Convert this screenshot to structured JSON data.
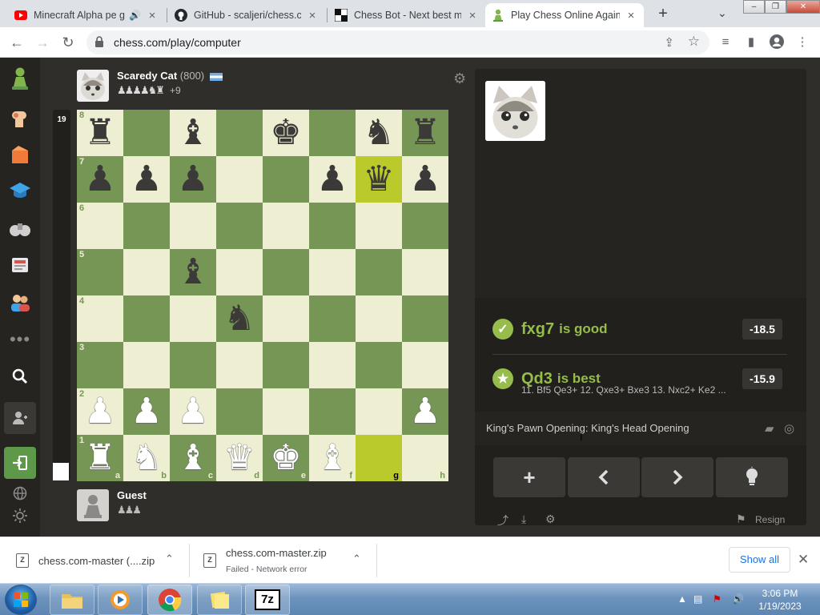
{
  "browser": {
    "tabs": [
      {
        "title": "Minecraft Alpha pe g",
        "favicon": "youtube-icon",
        "active": false
      },
      {
        "title": "GitHub - scaljeri/chess.co",
        "favicon": "github-icon",
        "active": false
      },
      {
        "title": "Chess Bot - Next best mo",
        "favicon": "chess-board-icon",
        "active": false
      },
      {
        "title": "Play Chess Online Agains",
        "favicon": "chess-pawn-icon",
        "active": true
      }
    ],
    "new_tab": "+",
    "tab_menu": "⌄",
    "url": "chess.com/play/computer"
  },
  "game": {
    "move_number": "19",
    "opponent": {
      "name": "Scaredy Cat",
      "rating": "(800)",
      "captured": "♟♟♟♟♞♜",
      "advantage": "+9"
    },
    "player": {
      "name": "Guest",
      "captured": "♟♟♟"
    },
    "board": [
      [
        "r",
        "",
        "b",
        "",
        "k",
        "",
        "n",
        "r"
      ],
      [
        "p",
        "p",
        "p",
        "",
        "",
        "p",
        "q",
        "p"
      ],
      [
        "",
        "",
        "",
        "",
        "",
        "",
        "",
        ""
      ],
      [
        "",
        "",
        "b",
        "",
        "",
        "",
        "",
        ""
      ],
      [
        "",
        "",
        "",
        "n",
        "",
        "",
        "",
        ""
      ],
      [
        "",
        "",
        "",
        "",
        "",
        "",
        "",
        ""
      ],
      [
        "P",
        "P",
        "P",
        "",
        "",
        "",
        "",
        "P"
      ],
      [
        "R",
        "N",
        "B",
        "Q",
        "K",
        "B",
        "",
        ""
      ]
    ],
    "highlight_squares": [
      "g7",
      "g1"
    ],
    "ranks": [
      "8",
      "7",
      "6",
      "5",
      "4",
      "3",
      "2",
      "1"
    ],
    "files": [
      "a",
      "b",
      "c",
      "d",
      "e",
      "f",
      "g",
      "h"
    ]
  },
  "coach": {
    "played": {
      "move": "fxg7",
      "verdict": "is good",
      "score": "-18.5",
      "color": "#96bc4b"
    },
    "best": {
      "move": "Qd3",
      "verdict": "is best",
      "score": "-15.9",
      "color": "#96bc4b"
    },
    "best_line": "11. Bf5 Qe3+ 12. Qxe3+ Bxe3 13. Nxc2+ Ke2 ...",
    "opening": "King's Pawn Opening: King's Head Opening"
  },
  "controls": {
    "new_game": "+",
    "back": "‹",
    "forward": "›",
    "hint": "hint",
    "resign": "Resign"
  },
  "downloads": {
    "items": [
      {
        "name": "chess.com-master (....zip",
        "status": ""
      },
      {
        "name": "chess.com-master.zip",
        "status": "Failed - Network error"
      }
    ],
    "show_all": "Show all"
  },
  "taskbar": {
    "time": "3:06 PM",
    "date": "1/19/2023"
  }
}
